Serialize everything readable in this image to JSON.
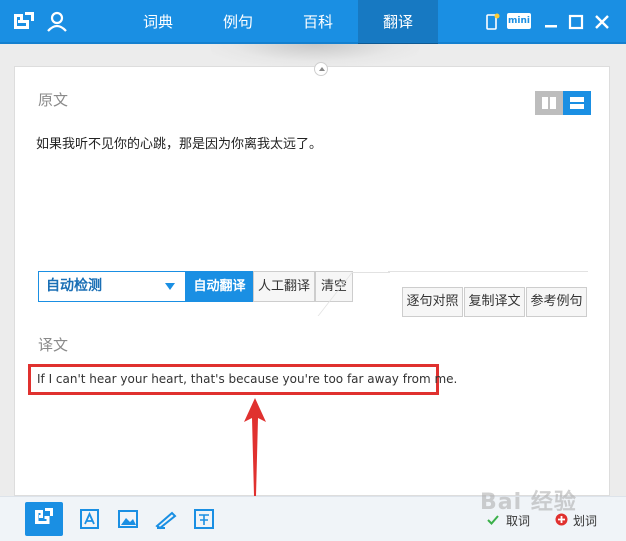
{
  "header": {
    "tabs": [
      {
        "label": "词典"
      },
      {
        "label": "例句"
      },
      {
        "label": "百科"
      },
      {
        "label": "翻译",
        "active": true
      }
    ],
    "mini_label": "mini",
    "icons": [
      "baidu-translate-logo",
      "user-icon",
      "phone-icon",
      "mini-mode-icon",
      "minimize-icon",
      "maximize-icon",
      "close-icon"
    ]
  },
  "source": {
    "label": "原文",
    "text": "如果我听不见你的心跳，那是因为你离我太远了。"
  },
  "toolbar": {
    "language_select": "自动检测",
    "auto_translate": "自动翻译",
    "human_translate": "人工翻译",
    "clear": "清空",
    "sentence_compare": "逐句对照",
    "copy_translation": "复制译文",
    "reference_examples": "参考例句"
  },
  "target": {
    "label": "译文",
    "text": "If I can't hear your heart, that's because you're too far away from me."
  },
  "bottom": {
    "cancel_word": "取词",
    "select_word": "划词",
    "watermark": "Bai 经验",
    "icons": [
      "home-icon",
      "text-recognize-icon",
      "image-icon",
      "edit-icon",
      "translate-icon"
    ]
  },
  "colors": {
    "brand_blue": "#1a8fe3",
    "highlight_red": "#e0312f"
  }
}
